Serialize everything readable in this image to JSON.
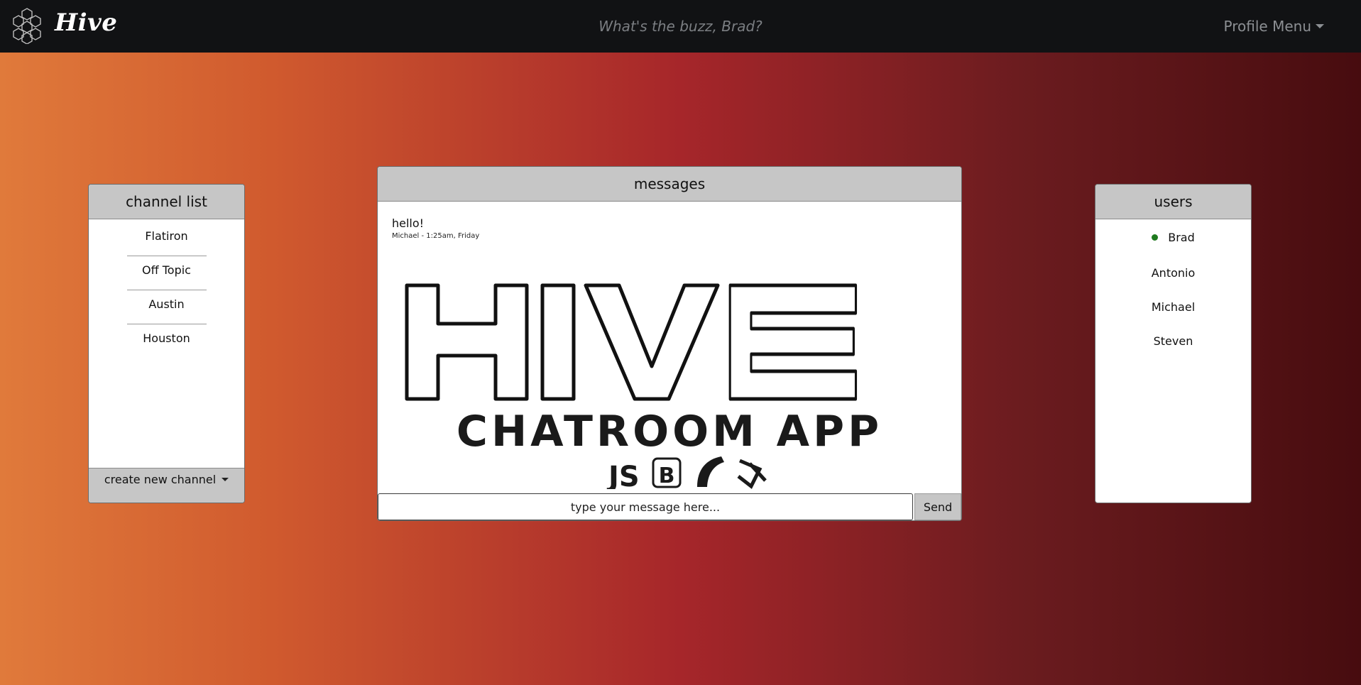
{
  "navbar": {
    "brand": "Hive",
    "buzz_prompt": "What's the buzz, Brad?",
    "profile_menu": "Profile Menu"
  },
  "channels": {
    "header": "channel list",
    "items": [
      "Flatiron",
      "Off Topic",
      "Austin",
      "Houston"
    ],
    "create_label": "create new channel"
  },
  "messages": {
    "header": "messages",
    "items": [
      {
        "text": "hello!",
        "meta": "Michael - 1:25am, Friday"
      }
    ],
    "logo": {
      "title": "HIVE",
      "subtitle": "CHATROOM APP",
      "tech_icons": [
        "javascript-icon",
        "bootstrap-icon",
        "rails-icon",
        "actioncable-icon"
      ]
    },
    "input_placeholder": "type your message here...",
    "send_label": "Send"
  },
  "users": {
    "header": "users",
    "items": [
      {
        "name": "Brad",
        "online": true
      },
      {
        "name": "Antonio",
        "online": false
      },
      {
        "name": "Michael",
        "online": false
      },
      {
        "name": "Steven",
        "online": false
      }
    ]
  },
  "colors": {
    "navbar_bg": "#111214",
    "panel_header_bg": "#c6c6c6",
    "online_dot": "#1f7a1f",
    "gradient_left": "#e07a3b",
    "gradient_mid": "#a6262a",
    "gradient_right": "#470c0f"
  }
}
